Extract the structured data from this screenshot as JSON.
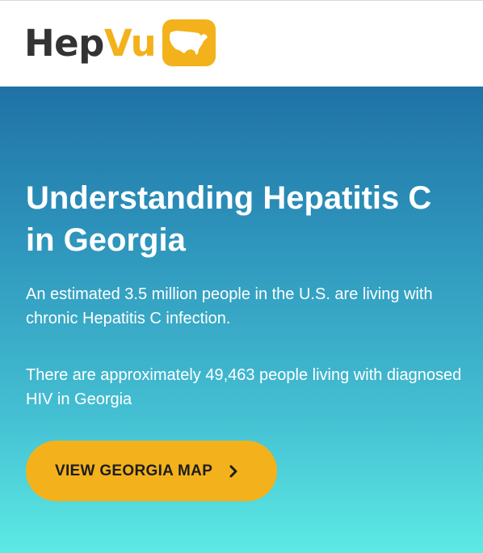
{
  "header": {
    "logo_part1": "Hep",
    "logo_part2": "Vu",
    "logo_icon": "us-map-icon",
    "colors": {
      "text_dark": "#333333",
      "accent": "#f3b21b"
    }
  },
  "hero": {
    "title": "Understanding Hepatitis C in Georgia",
    "paragraph1": "An estimated 3.5 million people in the U.S. are living with chronic Hepatitis C infection.",
    "paragraph2": "There are approximately 49,463 people living with diagnosed HIV in Georgia",
    "cta_label": "VIEW GEORGIA MAP",
    "cta_icon": "chevron-right-icon",
    "colors": {
      "gradient_top": "#1f72a6",
      "gradient_bottom": "#5ceae4",
      "button": "#f3b21b"
    }
  }
}
